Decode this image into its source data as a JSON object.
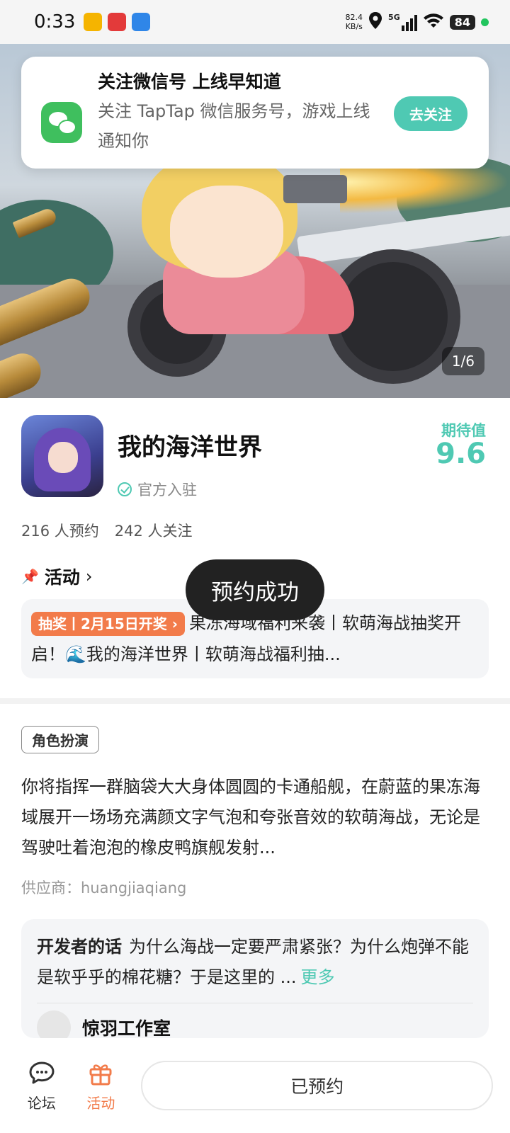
{
  "status_bar": {
    "time": "0:33",
    "net_speed_value": "82.4",
    "net_speed_unit": "KB/s",
    "network": "5G",
    "battery": "84"
  },
  "hero": {
    "page_indicator": "1/6"
  },
  "notification": {
    "title": "关注微信号 上线早知道",
    "description": "关注 TapTap 微信服务号，游戏上线通知你",
    "button_label": "去关注"
  },
  "game": {
    "title": "我的海洋世界",
    "official_label": "官方入驻",
    "expect_label": "期待值",
    "expect_score": "9.6",
    "reservations": "216 人预约",
    "followers": "242 人关注"
  },
  "activity": {
    "header": "活动",
    "tag": "抽奖丨2月15日开奖",
    "text": "果冻海域福利来袭丨软萌海战抽奖开启！🌊我的海洋世界丨软萌海战福利抽..."
  },
  "toast": {
    "message": "预约成功"
  },
  "details": {
    "genre_tag": "角色扮演",
    "description": "你将指挥一群脑袋大大身体圆圆的卡通船舰，在蔚蓝的果冻海域展开一场场充满颜文字气泡和夸张音效的软萌海战，无论是驾驶吐着泡泡的橡皮鸭旗舰发射...",
    "supplier": "供应商：huangjiaqiang"
  },
  "developer": {
    "label": "开发者的话",
    "text": "为什么海战一定要严肃紧张？为什么炮弹不能是软乎乎的棉花糖？于是这里的 ...",
    "more": "更多",
    "studio_name": "惊羽工作室"
  },
  "bottom_bar": {
    "forum_label": "论坛",
    "activity_label": "活动",
    "reserve_button": "已预约"
  },
  "colors": {
    "accent": "#4fc9b3",
    "activity_orange": "#f27b4a"
  }
}
